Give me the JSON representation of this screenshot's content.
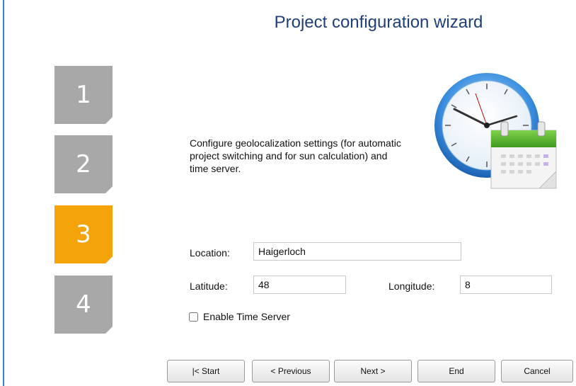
{
  "title": "Project configuration wizard",
  "steps": [
    {
      "label": "1",
      "active": false
    },
    {
      "label": "2",
      "active": false
    },
    {
      "label": "3",
      "active": true
    },
    {
      "label": "4",
      "active": false
    }
  ],
  "description": "Configure geolocalization settings (for automatic project switching and for sun calculation) and time server.",
  "icon": "clock-calendar-icon",
  "form": {
    "location_label": "Location:",
    "location_value": "Haigerloch",
    "latitude_label": "Latitude:",
    "latitude_value": "48",
    "longitude_label": "Longitude:",
    "longitude_value": "8",
    "time_server_label": "Enable Time Server",
    "time_server_checked": false
  },
  "buttons": {
    "start": "|< Start",
    "previous": "< Previous",
    "next": "Next >",
    "end": "End",
    "cancel": "Cancel"
  },
  "colors": {
    "active_step": "#f4a30a",
    "inactive_step": "#a8a8a8",
    "title": "#1f3f7a"
  }
}
